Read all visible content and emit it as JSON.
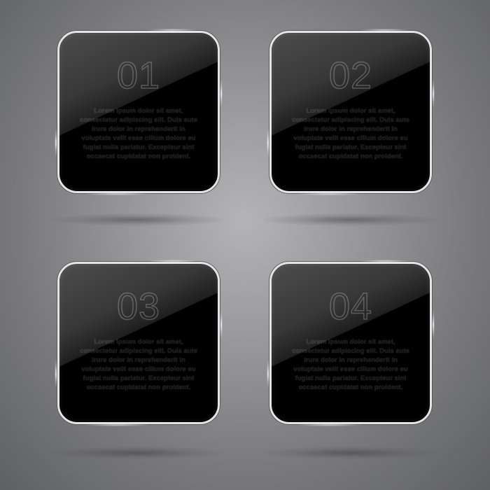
{
  "tiles": [
    {
      "number": "01",
      "text": "Lorem ipsum dolor sit amet, consectetur adipiscing elit. Duis aute irure dolor in reprehenderit in voluptate velit esse cillum dolore eu fugiat nulla pariatur. Excepteur sint occaecat cupidatat non proident."
    },
    {
      "number": "02",
      "text": "Lorem ipsum dolor sit amet, consectetur adipiscing elit. Duis aute irure dolor in reprehenderit in voluptate velit esse cillum dolore eu fugiat nulla pariatur. Excepteur sint occaecat cupidatat non proident."
    },
    {
      "number": "03",
      "text": "Lorem ipsum dolor sit amet, consectetur adipiscing elit. Duis aute irure dolor in reprehenderit in voluptate velit esse cillum dolore eu fugiat nulla pariatur. Excepteur sint occaecat cupidatat non proident."
    },
    {
      "number": "04",
      "text": "Lorem ipsum dolor sit amet, consectetur adipiscing elit. Duis aute irure dolor in reprehenderit in voluptate velit esse cillum dolore eu fugiat nulla pariatur. Excepteur sint occaecat cupidatat non proident."
    }
  ],
  "colors": {
    "tile_fill": "#000000",
    "tile_border": "#e4e4e6",
    "background_center": "#b4b4b6",
    "background_edge": "#5f6062"
  }
}
